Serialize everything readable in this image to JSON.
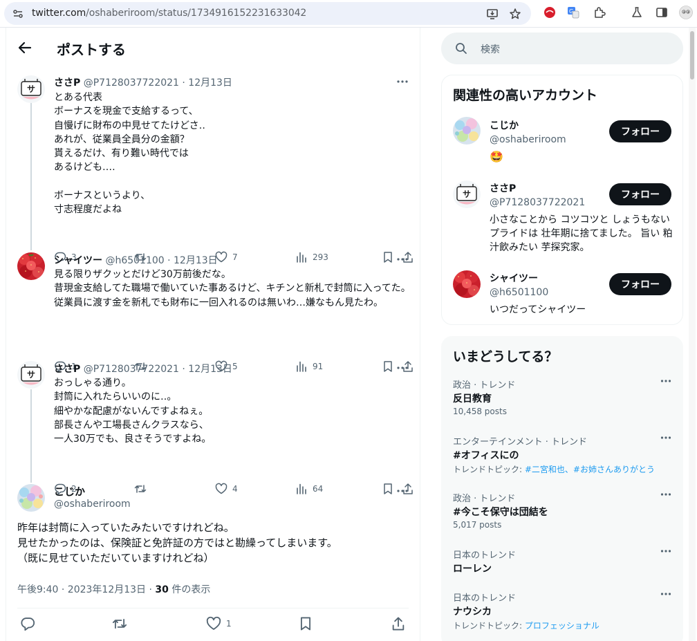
{
  "browser": {
    "url_host": "twitter.com",
    "url_path": "/oshaberiroom/status/1734916152231633042"
  },
  "header": {
    "title": "ポストする"
  },
  "thread": [
    {
      "name": "ささP",
      "meta": "@P7128037722021 · 12月13日",
      "body": "とある代表\nボーナスを現金で支給するって、\n自慢げに財布の中見せてたけどさ‥\nあれが、従業員全員分の金額？\n貰えるだけ、有り難い時代では\nあるけども‥‥\n\nボーナスというより、\n寸志程度だよね",
      "replies": "3",
      "reposts": "",
      "likes": "7",
      "views": "293"
    },
    {
      "name": "シャイツー",
      "meta": "@h6501100 · 12月13日",
      "body": "見る限りザクッとだけど30万前後だな。\n昔現金支給してた職場で働いていた事あるけど、キチンと新札で封筒に入ってた。従業員に渡す金を新札でも財布に一回入れるのは無いわ…嫌なもん見たわ。",
      "replies": "1",
      "reposts": "",
      "likes": "5",
      "views": "91"
    },
    {
      "name": "ささP",
      "meta": "@P7128037722021 · 12月13日",
      "body": "おっしゃる通り。\n封筒に入れたらいいのに‥。\n細やかな配慮がないんですよねぇ。\n部長さんや工場長さんクラスなら、\n一人30万でも、良さそうですよね。",
      "replies": "2",
      "reposts": "",
      "likes": "4",
      "views": "64"
    }
  ],
  "focus": {
    "name": "こじか",
    "handle": "@oshaberiroom",
    "body": "昨年は封筒に入っていたみたいですけれどね。\n見せたかったのは、保険証と免許証の方ではと勘繰ってしまいます。\n（既に見せていただいていますけれどね）",
    "time": "午後9:40 · 2023年12月13日 · ",
    "views_count": "30",
    "views_label": " 件の表示",
    "likes": "1"
  },
  "sidebar": {
    "search_placeholder": "検索",
    "related_title": "関連性の高いアカウント",
    "follow_label": "フォロー",
    "accounts": [
      {
        "name": "こじか",
        "handle": "@oshaberiroom",
        "bio": "🤩"
      },
      {
        "name": "ささP",
        "handle": "@P7128037722021",
        "bio": "小さなことから コツコツと しょうもないプライドは 壮年期に捨てました。 旨い 粕汁飲みたい 芋探究家。"
      },
      {
        "name": "シャイツー",
        "handle": "@h6501100",
        "bio": "いつだってシャイツー"
      }
    ],
    "trends_title": "いまどうしてる？",
    "trends": [
      {
        "category": "政治 · トレンド",
        "name": "反日教育",
        "sub": "10,458 posts",
        "sub_prefix": "",
        "links": ""
      },
      {
        "category": "エンターテインメント · トレンド",
        "name": "#オフィスにの",
        "sub": "",
        "sub_prefix": "トレンドトピック: ",
        "links": "#二宮和也、#お姉さんありがとう"
      },
      {
        "category": "政治 · トレンド",
        "name": "#今こそ保守は団結を",
        "sub": "5,017 posts",
        "sub_prefix": "",
        "links": ""
      },
      {
        "category": "日本のトレンド",
        "name": "ローレン",
        "sub": "",
        "sub_prefix": "",
        "links": ""
      },
      {
        "category": "日本のトレンド",
        "name": "ナウシカ",
        "sub": "",
        "sub_prefix": "トレンドトピック: ",
        "links": "プロフェッショナル"
      }
    ]
  },
  "colors": {
    "accent": "#1d9bf0",
    "text": "#0f1419",
    "muted": "#536471",
    "follow_bg": "#0f1419"
  }
}
